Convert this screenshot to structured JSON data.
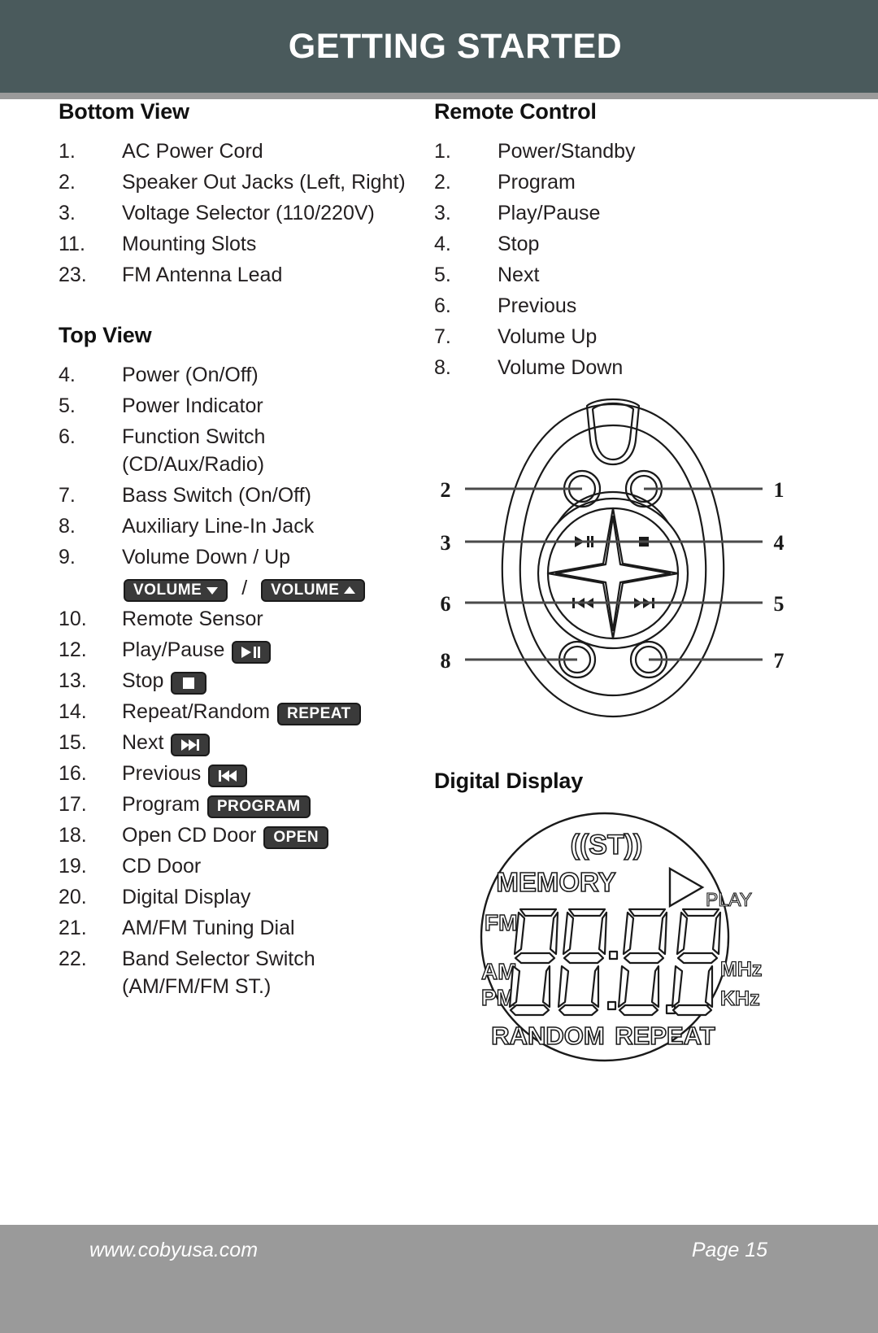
{
  "header": {
    "title": "GETTING STARTED"
  },
  "left_column": {
    "bottom_view": {
      "title": "Bottom View",
      "items": [
        {
          "num": "1.",
          "text": "AC Power Cord"
        },
        {
          "num": "2.",
          "text": "Speaker Out Jacks (Left, Right)"
        },
        {
          "num": "3.",
          "text": "Voltage Selector (110/220V)"
        },
        {
          "num": "11.",
          "text": "Mounting Slots"
        },
        {
          "num": "23.",
          "text": "FM Antenna Lead"
        }
      ]
    },
    "top_view": {
      "title": "Top View",
      "items": [
        {
          "num": "4.",
          "text": "Power (On/Off)"
        },
        {
          "num": "5.",
          "text": "Power Indicator"
        },
        {
          "num": "6.",
          "text": "Function Switch (CD/Aux/Radio)"
        },
        {
          "num": "7.",
          "text": "Bass Switch (On/Off)"
        },
        {
          "num": "8.",
          "text": "Auxiliary Line-In Jack"
        },
        {
          "num": "9.",
          "text": "Volume Down / Up"
        },
        {
          "num": "10.",
          "text": "Remote Sensor"
        },
        {
          "num": "12.",
          "text": "Play/Pause"
        },
        {
          "num": "13.",
          "text": "Stop"
        },
        {
          "num": "14.",
          "text": "Repeat/Random"
        },
        {
          "num": "15.",
          "text": "Next"
        },
        {
          "num": "16.",
          "text": "Previous"
        },
        {
          "num": "17.",
          "text": "Program"
        },
        {
          "num": "18.",
          "text": "Open CD Door"
        },
        {
          "num": "19.",
          "text": "CD Door"
        },
        {
          "num": "20.",
          "text": "Digital Display"
        },
        {
          "num": "21.",
          "text": "AM/FM Tuning Dial"
        },
        {
          "num": "22.",
          "text": "Band Selector Switch (AM/FM/FM ST.)"
        }
      ],
      "badges": {
        "volume_down": "VOLUME",
        "volume_up": "VOLUME",
        "separator": "/",
        "repeat": "REPEAT",
        "program": "PROGRAM",
        "open": "OPEN"
      }
    }
  },
  "right_column": {
    "remote_control": {
      "title": "Remote Control",
      "items": [
        {
          "num": "1.",
          "text": "Power/Standby"
        },
        {
          "num": "2.",
          "text": "Program"
        },
        {
          "num": "3.",
          "text": "Play/Pause"
        },
        {
          "num": "4.",
          "text": "Stop"
        },
        {
          "num": "5.",
          "text": "Next"
        },
        {
          "num": "6.",
          "text": "Previous"
        },
        {
          "num": "7.",
          "text": "Volume Up"
        },
        {
          "num": "8.",
          "text": "Volume Down"
        }
      ],
      "diagram_callouts_left": [
        "2",
        "3",
        "6",
        "8"
      ],
      "diagram_callouts_right": [
        "1",
        "4",
        "5",
        "7"
      ]
    },
    "digital_display": {
      "title": "Digital Display",
      "indicators": {
        "stereo": "((ST))",
        "memory": "MEMORY",
        "play": "PLAY",
        "fm": "FM",
        "am": "AM",
        "pm": "PM",
        "mhz": "MHz",
        "khz": "KHz",
        "random": "RANDOM",
        "repeat": "REPEAT"
      },
      "segment_readout": "88:8.8"
    }
  },
  "footer": {
    "website": "www.cobyusa.com",
    "page": "Page 15"
  }
}
